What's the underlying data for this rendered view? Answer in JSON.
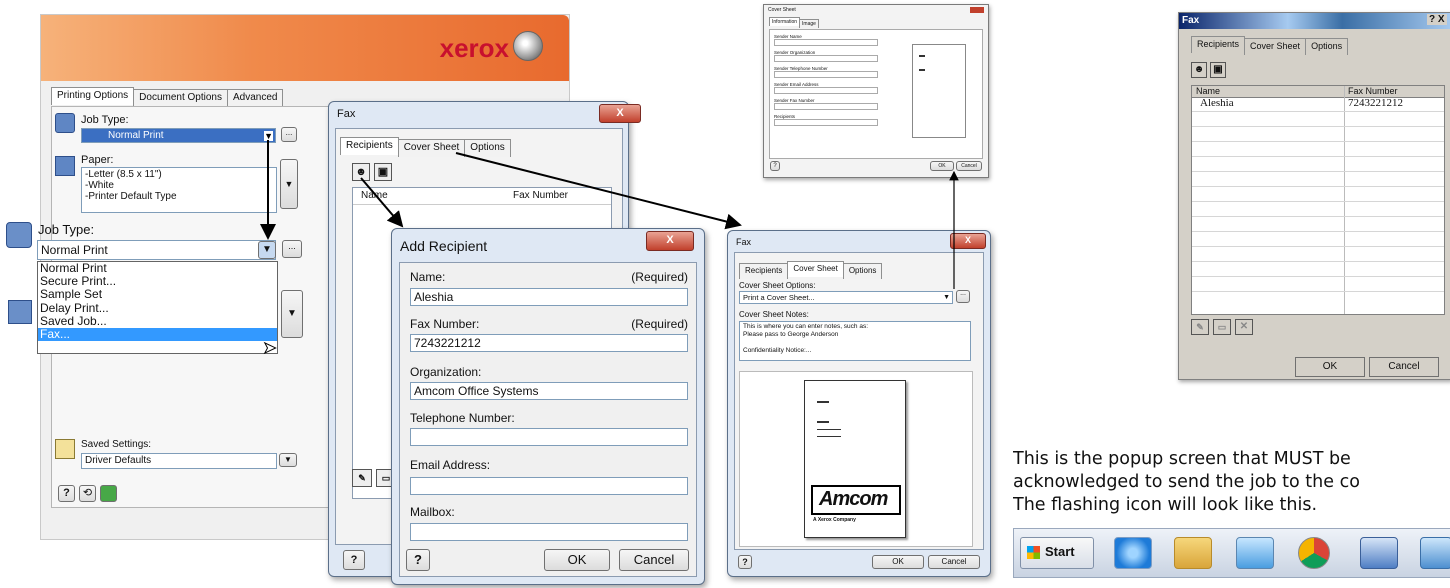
{
  "printer": {
    "brand": "xerox",
    "tabs": [
      "Printing Options",
      "Document Options",
      "Advanced"
    ],
    "job_type_label": "Job Type:",
    "job_type_value": "Normal Print",
    "paper_label": "Paper:",
    "paper_lines": [
      "-Letter (8.5 x 11\")",
      "-White",
      "-Printer Default Type"
    ],
    "saved_settings_label": "Saved Settings:",
    "saved_settings_value": "Driver Defaults",
    "more": "...",
    "help": "?"
  },
  "jobtype_dropdown": {
    "label": "Job Type:",
    "value": "Normal Print",
    "options": [
      "Normal Print",
      "Secure Print...",
      "Sample Set",
      "Delay Print...",
      "Saved Job...",
      "Fax..."
    ],
    "selected_index": 5
  },
  "fax1": {
    "title": "Fax",
    "tabs": [
      "Recipients",
      "Cover Sheet",
      "Options"
    ],
    "columns": [
      "Name",
      "Fax Number"
    ],
    "help": "?"
  },
  "add_recipient": {
    "title": "Add Recipient",
    "name_label": "Name:",
    "name_req": "(Required)",
    "name_value": "Aleshia",
    "fax_label": "Fax Number:",
    "fax_req": "(Required)",
    "fax_value": "7243221212",
    "org_label": "Organization:",
    "org_value": "Amcom Office Systems",
    "tel_label": "Telephone Number:",
    "email_label": "Email Address:",
    "mailbox_label": "Mailbox:",
    "help": "?",
    "ok": "OK",
    "cancel": "Cancel"
  },
  "cover_mini": {
    "title": "Cover Sheet",
    "tabs": [
      "Information",
      "Image"
    ],
    "fields": [
      "Sender Name",
      "Sender Organization",
      "Sender Telephone Number",
      "Sender Email Address",
      "Sender Fax Number",
      "Recipients"
    ],
    "ok": "OK",
    "cancel": "Cancel",
    "help": "?"
  },
  "fax2": {
    "title": "Fax",
    "tabs": [
      "Recipients",
      "Cover Sheet",
      "Options"
    ],
    "options_label": "Cover Sheet Options:",
    "options_value": "Print a Cover Sheet...",
    "notes_label": "Cover Sheet Notes:",
    "notes_lines": [
      "This is where you can enter notes, such as:",
      "Please pass to George Anderson",
      "",
      "Confidentiality Notice:..."
    ],
    "logo": "Amcom",
    "logo_sub": "A Xerox Company",
    "help": "?",
    "ok": "OK",
    "cancel": "Cancel"
  },
  "fax_popup": {
    "title": "Fax",
    "tabs": [
      "Recipients",
      "Cover Sheet",
      "Options"
    ],
    "columns": [
      "Name",
      "Fax Number"
    ],
    "row": {
      "name": "Aleshia",
      "fax": "7243221212"
    },
    "ok": "OK",
    "cancel": "Cancel",
    "titlebar_buttons": "? X"
  },
  "note": {
    "lines": [
      "This is the popup screen that MUST be",
      "acknowledged to send the job to the co",
      "The flashing icon will look like this."
    ]
  },
  "taskbar": {
    "start": "Start"
  }
}
